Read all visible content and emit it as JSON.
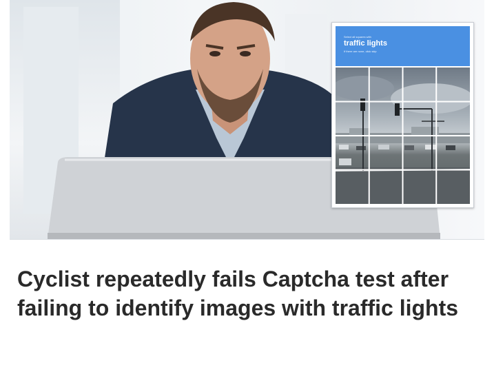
{
  "article": {
    "headline": "Cyclist repeatedly fails Captcha test after failing to identify images with traffic lights"
  },
  "captcha": {
    "prompt_pre": "Select all squares with",
    "target": "traffic lights",
    "prompt_sub": "If there are none, click skip"
  },
  "colors": {
    "captcha_header": "#4a90e2",
    "headline_text": "#2a2a2a"
  }
}
